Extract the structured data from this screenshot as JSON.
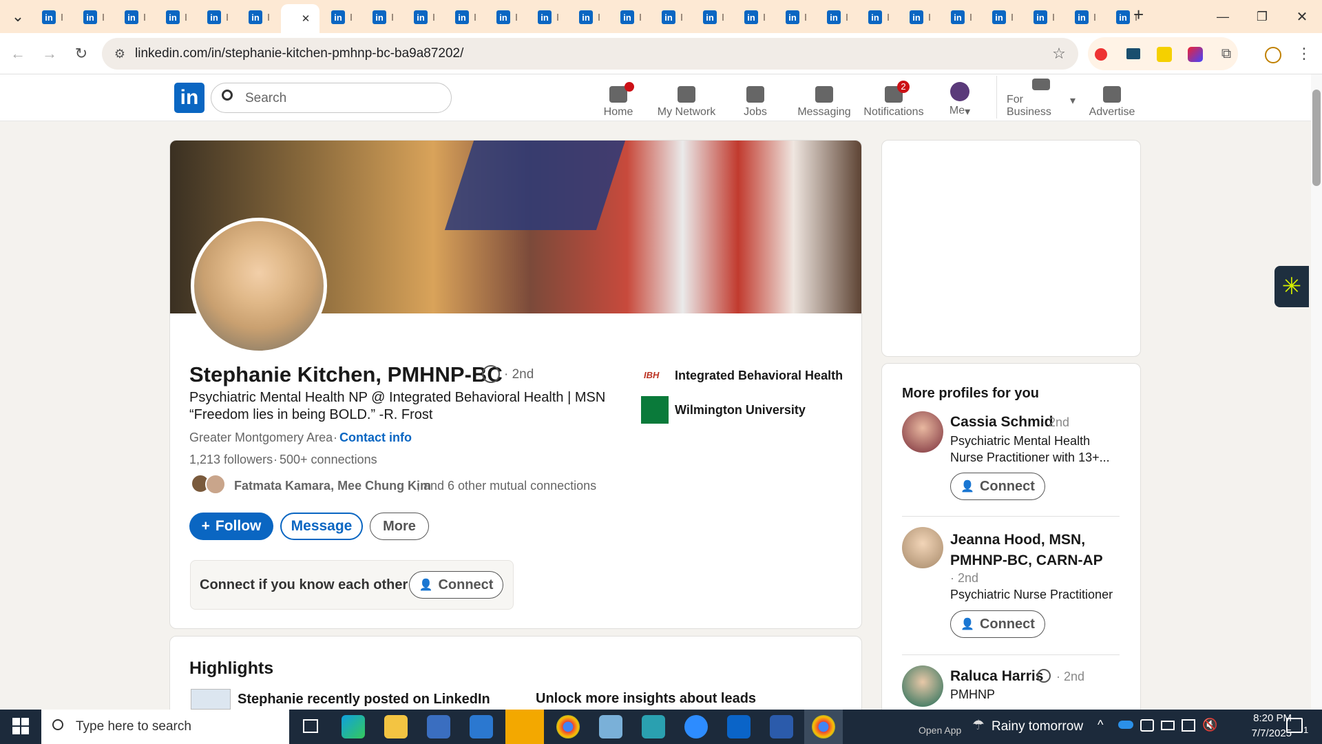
{
  "browser": {
    "url": "linkedin.com/in/stephanie-kitchen-pmhnp-bc-ba9a87202/",
    "tab_favicon_text": "in",
    "close_tab": "✕",
    "new_tab": "+",
    "tab_count": 27
  },
  "header": {
    "logo": "in",
    "search_placeholder": "Search",
    "nav": [
      {
        "label": "Home",
        "icon": "home-icon",
        "badge": ""
      },
      {
        "label": "My Network",
        "icon": "people-icon",
        "badge": ""
      },
      {
        "label": "Jobs",
        "icon": "briefcase-icon",
        "badge": ""
      },
      {
        "label": "Messaging",
        "icon": "chat-icon",
        "badge": ""
      },
      {
        "label": "Notifications",
        "icon": "bell-icon",
        "badge": "2"
      },
      {
        "label": "Me",
        "icon": "avatar",
        "badge": ""
      },
      {
        "label": "For Business",
        "icon": "grid-icon",
        "badge": ""
      },
      {
        "label": "Advertise",
        "icon": "advertise-icon",
        "badge": ""
      }
    ]
  },
  "profile": {
    "name": "Stephanie Kitchen, PMHNP-BC",
    "degree": "· 2nd",
    "headline_line1": "Psychiatric Mental Health NP @ Integrated Behavioral Health | MSN",
    "headline_line2": "“Freedom lies in being BOLD.” -R. Frost",
    "location": "Greater Montgomery Area",
    "contact": "Contact info",
    "followers": "1,213 followers",
    "connections": "500+ connections",
    "mutual_names": "Fatmata Kamara, Mee Chung Kim",
    "mutual_rest": ", and 6 other mutual connections",
    "company": "Integrated Behavioral Health",
    "company_logo": "IBH",
    "school": "Wilmington University",
    "follow_button": "Follow",
    "message_button": "Message",
    "more_button": "More",
    "connect_prompt": "Connect if you know each other",
    "connect_button": "Connect"
  },
  "highlights": {
    "title": "Highlights",
    "item1": "Stephanie recently posted on LinkedIn",
    "item2": "Unlock more insights about leads"
  },
  "sidebar": {
    "title": "More profiles for you",
    "profiles": [
      {
        "name": "Cassia Schmid",
        "degree": "· 2nd",
        "headline": "Psychiatric Mental Health Nurse Practitioner with 13+...",
        "button": "Connect"
      },
      {
        "name": "Jeanna Hood, MSN, PMHNP-BC, CARN-AP",
        "degree": "· 2nd",
        "headline": "Psychiatric Nurse Practitioner",
        "button": "Connect"
      },
      {
        "name": "Raluca Harris",
        "degree": "· 2nd",
        "headline": "PMHNP",
        "button": ""
      }
    ]
  },
  "taskbar": {
    "search_placeholder": "Type here to search",
    "weather": "Rainy tomorrow",
    "open_app": "Open App",
    "time": "8:20 PM",
    "date": "7/7/2025",
    "notif_count": "1"
  },
  "colors": {
    "brand": "#0a66c2",
    "tabstrip": "#fde9d4",
    "badge": "#cc1016",
    "taskbar": "#1c2a3b"
  }
}
